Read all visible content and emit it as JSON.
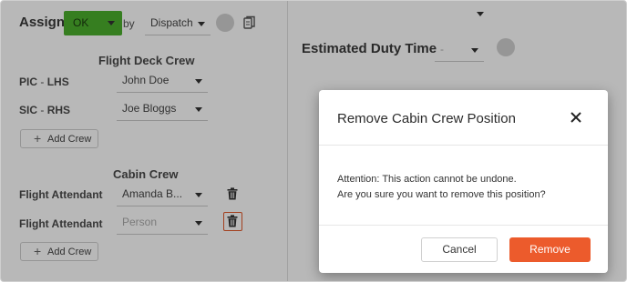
{
  "header": {
    "assign_label": "Assign",
    "status_value": "OK",
    "by_label": "by",
    "dispatch_value": "Dispatch"
  },
  "duty": {
    "label": "Estimated Duty Time",
    "value": "-"
  },
  "flight_deck": {
    "title": "Flight Deck Crew",
    "rows": [
      {
        "role": "PIC",
        "sep": "-",
        "seat": "LHS",
        "value": "John Doe"
      },
      {
        "role": "SIC",
        "sep": "-",
        "seat": "RHS",
        "value": "Joe Bloggs"
      }
    ],
    "add_label": "Add Crew"
  },
  "cabin": {
    "title": "Cabin Crew",
    "rows": [
      {
        "role": "Flight Attendant",
        "value": "Amanda B..."
      },
      {
        "role": "Flight Attendant",
        "placeholder": "Person"
      }
    ],
    "add_label": "Add Crew"
  },
  "modal": {
    "title": "Remove Cabin Crew Position",
    "body_line1": "Attention: This action cannot be undone.",
    "body_line2": "Are you sure you want to remove this position?",
    "cancel_label": "Cancel",
    "remove_label": "Remove"
  },
  "colors": {
    "status_green": "#4caf2d",
    "danger_orange": "#ec5b2c"
  },
  "icons": {
    "copy": "copy-icon",
    "trash": "trash-icon",
    "close": "close-icon",
    "caret": "chevron-down-icon"
  }
}
